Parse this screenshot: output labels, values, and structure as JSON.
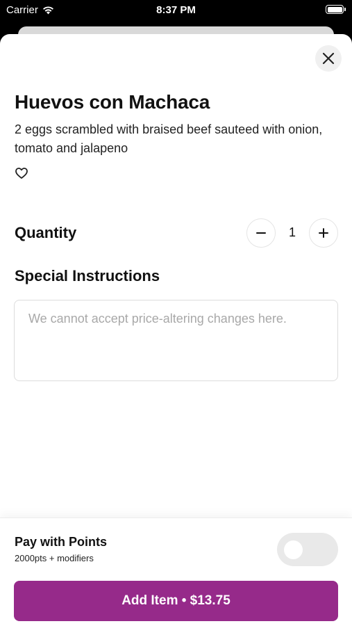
{
  "status_bar": {
    "carrier": "Carrier",
    "time": "8:37 PM",
    "icons": [
      "wifi-icon",
      "battery-icon"
    ]
  },
  "item": {
    "title": "Huevos con Machaca",
    "description": "2 eggs scrambled with braised beef sauteed with onion, tomato and jalapeno",
    "favorite_icon": "heart-outline-icon"
  },
  "close_icon": "close-icon",
  "quantity": {
    "label": "Quantity",
    "value": "1",
    "decrement_icon": "minus-icon",
    "increment_icon": "plus-icon"
  },
  "instructions": {
    "label": "Special Instructions",
    "placeholder": "We cannot accept price-altering changes here.",
    "value": ""
  },
  "points": {
    "title": "Pay with Points",
    "subtitle": "2000pts + modifiers",
    "enabled": false
  },
  "add_button": {
    "label": "Add Item • $13.75",
    "color": "#962a8a"
  }
}
